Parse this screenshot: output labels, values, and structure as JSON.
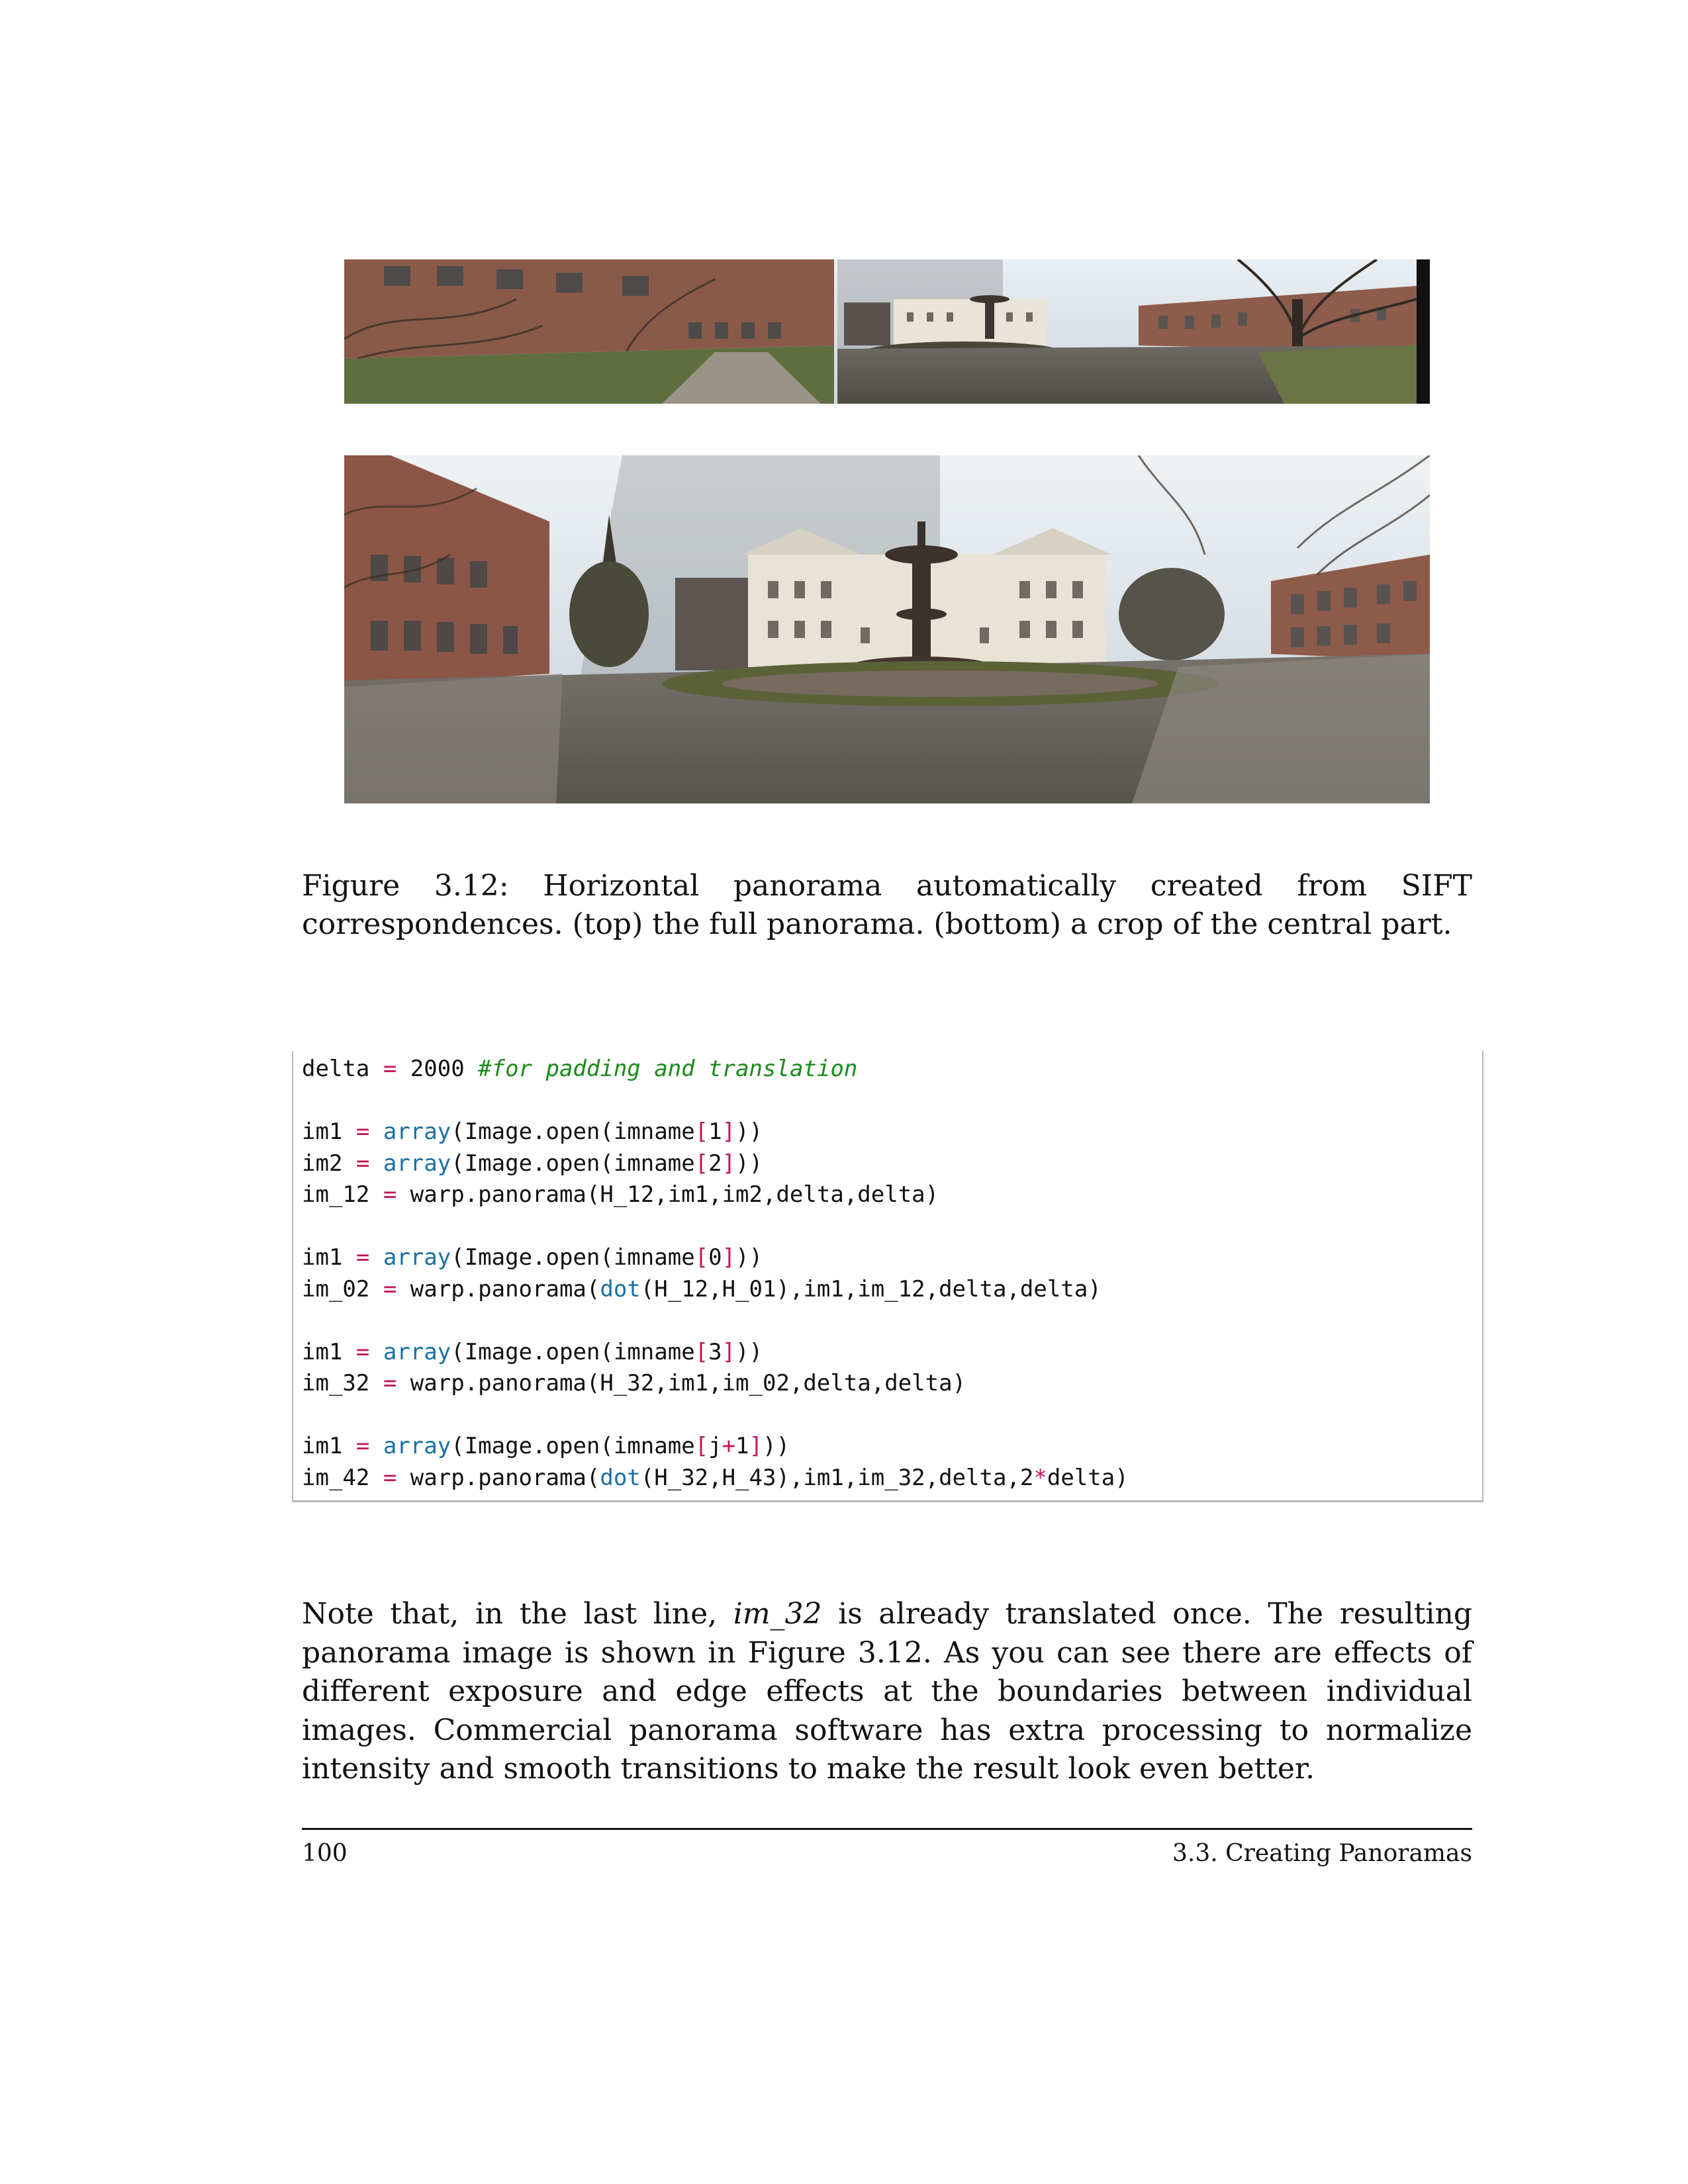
{
  "figure": {
    "caption": "Figure 3.12: Horizontal panorama automatically created from SIFT correspondences. (top) the full panorama. (bottom) a crop of the central part."
  },
  "code": {
    "lines": [
      [
        {
          "t": "delta ",
          "c": ""
        },
        {
          "t": "=",
          "c": "op"
        },
        {
          "t": " 2000 ",
          "c": ""
        },
        {
          "t": "#for padding and translation",
          "c": "cm"
        }
      ],
      [],
      [
        {
          "t": "im1 ",
          "c": ""
        },
        {
          "t": "=",
          "c": "op"
        },
        {
          "t": " ",
          "c": ""
        },
        {
          "t": "array",
          "c": "fn"
        },
        {
          "t": "(Image.open(imname",
          "c": ""
        },
        {
          "t": "[",
          "c": "op"
        },
        {
          "t": "1",
          "c": ""
        },
        {
          "t": "]",
          "c": "op"
        },
        {
          "t": "))",
          "c": ""
        }
      ],
      [
        {
          "t": "im2 ",
          "c": ""
        },
        {
          "t": "=",
          "c": "op"
        },
        {
          "t": " ",
          "c": ""
        },
        {
          "t": "array",
          "c": "fn"
        },
        {
          "t": "(Image.open(imname",
          "c": ""
        },
        {
          "t": "[",
          "c": "op"
        },
        {
          "t": "2",
          "c": ""
        },
        {
          "t": "]",
          "c": "op"
        },
        {
          "t": "))",
          "c": ""
        }
      ],
      [
        {
          "t": "im_12 ",
          "c": ""
        },
        {
          "t": "=",
          "c": "op"
        },
        {
          "t": " warp.panorama(H_12,im1,im2,delta,delta)",
          "c": ""
        }
      ],
      [],
      [
        {
          "t": "im1 ",
          "c": ""
        },
        {
          "t": "=",
          "c": "op"
        },
        {
          "t": " ",
          "c": ""
        },
        {
          "t": "array",
          "c": "fn"
        },
        {
          "t": "(Image.open(imname",
          "c": ""
        },
        {
          "t": "[",
          "c": "op"
        },
        {
          "t": "0",
          "c": ""
        },
        {
          "t": "]",
          "c": "op"
        },
        {
          "t": "))",
          "c": ""
        }
      ],
      [
        {
          "t": "im_02 ",
          "c": ""
        },
        {
          "t": "=",
          "c": "op"
        },
        {
          "t": " warp.panorama(",
          "c": ""
        },
        {
          "t": "dot",
          "c": "fn"
        },
        {
          "t": "(H_12,H_01),im1,im_12,delta,delta)",
          "c": ""
        }
      ],
      [],
      [
        {
          "t": "im1 ",
          "c": ""
        },
        {
          "t": "=",
          "c": "op"
        },
        {
          "t": " ",
          "c": ""
        },
        {
          "t": "array",
          "c": "fn"
        },
        {
          "t": "(Image.open(imname",
          "c": ""
        },
        {
          "t": "[",
          "c": "op"
        },
        {
          "t": "3",
          "c": ""
        },
        {
          "t": "]",
          "c": "op"
        },
        {
          "t": "))",
          "c": ""
        }
      ],
      [
        {
          "t": "im_32 ",
          "c": ""
        },
        {
          "t": "=",
          "c": "op"
        },
        {
          "t": " warp.panorama(H_32,im1,im_02,delta,delta)",
          "c": ""
        }
      ],
      [],
      [
        {
          "t": "im1 ",
          "c": ""
        },
        {
          "t": "=",
          "c": "op"
        },
        {
          "t": " ",
          "c": ""
        },
        {
          "t": "array",
          "c": "fn"
        },
        {
          "t": "(Image.open(imname",
          "c": ""
        },
        {
          "t": "[",
          "c": "op"
        },
        {
          "t": "j",
          "c": ""
        },
        {
          "t": "+",
          "c": "op"
        },
        {
          "t": "1",
          "c": ""
        },
        {
          "t": "]",
          "c": "op"
        },
        {
          "t": "))",
          "c": ""
        }
      ],
      [
        {
          "t": "im_42 ",
          "c": ""
        },
        {
          "t": "=",
          "c": "op"
        },
        {
          "t": " warp.panorama(",
          "c": ""
        },
        {
          "t": "dot",
          "c": "fn"
        },
        {
          "t": "(H_32,H_43),im1,im_32,delta,2",
          "c": ""
        },
        {
          "t": "*",
          "c": "op"
        },
        {
          "t": "delta)",
          "c": ""
        }
      ]
    ]
  },
  "body": {
    "part1": "Note that, in the last line, ",
    "italic": "im_32",
    "part2": " is already translated once. The resulting panorama image is shown in Figure 3.12. As you can see there are effects of different exposure and edge effects at the boundaries between individual images. Commercial panorama software has extra processing to normalize intensity and smooth transitions to make the result look even better."
  },
  "footer": {
    "page_number": "100",
    "section": "3.3. Creating Panoramas"
  },
  "colors": {
    "operator": "#c2185b",
    "function": "#1a6fa3",
    "comment": "#1b8a1b"
  }
}
